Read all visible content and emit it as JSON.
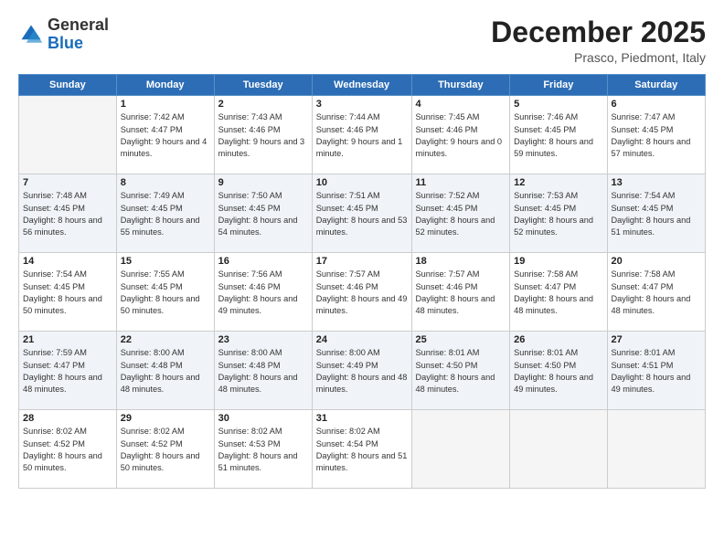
{
  "header": {
    "logo_general": "General",
    "logo_blue": "Blue",
    "month_year": "December 2025",
    "location": "Prasco, Piedmont, Italy"
  },
  "weekdays": [
    "Sunday",
    "Monday",
    "Tuesday",
    "Wednesday",
    "Thursday",
    "Friday",
    "Saturday"
  ],
  "weeks": [
    [
      {
        "day": "",
        "sunrise": "",
        "sunset": "",
        "daylight": ""
      },
      {
        "day": "1",
        "sunrise": "Sunrise: 7:42 AM",
        "sunset": "Sunset: 4:47 PM",
        "daylight": "Daylight: 9 hours and 4 minutes."
      },
      {
        "day": "2",
        "sunrise": "Sunrise: 7:43 AM",
        "sunset": "Sunset: 4:46 PM",
        "daylight": "Daylight: 9 hours and 3 minutes."
      },
      {
        "day": "3",
        "sunrise": "Sunrise: 7:44 AM",
        "sunset": "Sunset: 4:46 PM",
        "daylight": "Daylight: 9 hours and 1 minute."
      },
      {
        "day": "4",
        "sunrise": "Sunrise: 7:45 AM",
        "sunset": "Sunset: 4:46 PM",
        "daylight": "Daylight: 9 hours and 0 minutes."
      },
      {
        "day": "5",
        "sunrise": "Sunrise: 7:46 AM",
        "sunset": "Sunset: 4:45 PM",
        "daylight": "Daylight: 8 hours and 59 minutes."
      },
      {
        "day": "6",
        "sunrise": "Sunrise: 7:47 AM",
        "sunset": "Sunset: 4:45 PM",
        "daylight": "Daylight: 8 hours and 57 minutes."
      }
    ],
    [
      {
        "day": "7",
        "sunrise": "Sunrise: 7:48 AM",
        "sunset": "Sunset: 4:45 PM",
        "daylight": "Daylight: 8 hours and 56 minutes."
      },
      {
        "day": "8",
        "sunrise": "Sunrise: 7:49 AM",
        "sunset": "Sunset: 4:45 PM",
        "daylight": "Daylight: 8 hours and 55 minutes."
      },
      {
        "day": "9",
        "sunrise": "Sunrise: 7:50 AM",
        "sunset": "Sunset: 4:45 PM",
        "daylight": "Daylight: 8 hours and 54 minutes."
      },
      {
        "day": "10",
        "sunrise": "Sunrise: 7:51 AM",
        "sunset": "Sunset: 4:45 PM",
        "daylight": "Daylight: 8 hours and 53 minutes."
      },
      {
        "day": "11",
        "sunrise": "Sunrise: 7:52 AM",
        "sunset": "Sunset: 4:45 PM",
        "daylight": "Daylight: 8 hours and 52 minutes."
      },
      {
        "day": "12",
        "sunrise": "Sunrise: 7:53 AM",
        "sunset": "Sunset: 4:45 PM",
        "daylight": "Daylight: 8 hours and 52 minutes."
      },
      {
        "day": "13",
        "sunrise": "Sunrise: 7:54 AM",
        "sunset": "Sunset: 4:45 PM",
        "daylight": "Daylight: 8 hours and 51 minutes."
      }
    ],
    [
      {
        "day": "14",
        "sunrise": "Sunrise: 7:54 AM",
        "sunset": "Sunset: 4:45 PM",
        "daylight": "Daylight: 8 hours and 50 minutes."
      },
      {
        "day": "15",
        "sunrise": "Sunrise: 7:55 AM",
        "sunset": "Sunset: 4:45 PM",
        "daylight": "Daylight: 8 hours and 50 minutes."
      },
      {
        "day": "16",
        "sunrise": "Sunrise: 7:56 AM",
        "sunset": "Sunset: 4:46 PM",
        "daylight": "Daylight: 8 hours and 49 minutes."
      },
      {
        "day": "17",
        "sunrise": "Sunrise: 7:57 AM",
        "sunset": "Sunset: 4:46 PM",
        "daylight": "Daylight: 8 hours and 49 minutes."
      },
      {
        "day": "18",
        "sunrise": "Sunrise: 7:57 AM",
        "sunset": "Sunset: 4:46 PM",
        "daylight": "Daylight: 8 hours and 48 minutes."
      },
      {
        "day": "19",
        "sunrise": "Sunrise: 7:58 AM",
        "sunset": "Sunset: 4:47 PM",
        "daylight": "Daylight: 8 hours and 48 minutes."
      },
      {
        "day": "20",
        "sunrise": "Sunrise: 7:58 AM",
        "sunset": "Sunset: 4:47 PM",
        "daylight": "Daylight: 8 hours and 48 minutes."
      }
    ],
    [
      {
        "day": "21",
        "sunrise": "Sunrise: 7:59 AM",
        "sunset": "Sunset: 4:47 PM",
        "daylight": "Daylight: 8 hours and 48 minutes."
      },
      {
        "day": "22",
        "sunrise": "Sunrise: 8:00 AM",
        "sunset": "Sunset: 4:48 PM",
        "daylight": "Daylight: 8 hours and 48 minutes."
      },
      {
        "day": "23",
        "sunrise": "Sunrise: 8:00 AM",
        "sunset": "Sunset: 4:48 PM",
        "daylight": "Daylight: 8 hours and 48 minutes."
      },
      {
        "day": "24",
        "sunrise": "Sunrise: 8:00 AM",
        "sunset": "Sunset: 4:49 PM",
        "daylight": "Daylight: 8 hours and 48 minutes."
      },
      {
        "day": "25",
        "sunrise": "Sunrise: 8:01 AM",
        "sunset": "Sunset: 4:50 PM",
        "daylight": "Daylight: 8 hours and 48 minutes."
      },
      {
        "day": "26",
        "sunrise": "Sunrise: 8:01 AM",
        "sunset": "Sunset: 4:50 PM",
        "daylight": "Daylight: 8 hours and 49 minutes."
      },
      {
        "day": "27",
        "sunrise": "Sunrise: 8:01 AM",
        "sunset": "Sunset: 4:51 PM",
        "daylight": "Daylight: 8 hours and 49 minutes."
      }
    ],
    [
      {
        "day": "28",
        "sunrise": "Sunrise: 8:02 AM",
        "sunset": "Sunset: 4:52 PM",
        "daylight": "Daylight: 8 hours and 50 minutes."
      },
      {
        "day": "29",
        "sunrise": "Sunrise: 8:02 AM",
        "sunset": "Sunset: 4:52 PM",
        "daylight": "Daylight: 8 hours and 50 minutes."
      },
      {
        "day": "30",
        "sunrise": "Sunrise: 8:02 AM",
        "sunset": "Sunset: 4:53 PM",
        "daylight": "Daylight: 8 hours and 51 minutes."
      },
      {
        "day": "31",
        "sunrise": "Sunrise: 8:02 AM",
        "sunset": "Sunset: 4:54 PM",
        "daylight": "Daylight: 8 hours and 51 minutes."
      },
      {
        "day": "",
        "sunrise": "",
        "sunset": "",
        "daylight": ""
      },
      {
        "day": "",
        "sunrise": "",
        "sunset": "",
        "daylight": ""
      },
      {
        "day": "",
        "sunrise": "",
        "sunset": "",
        "daylight": ""
      }
    ]
  ]
}
